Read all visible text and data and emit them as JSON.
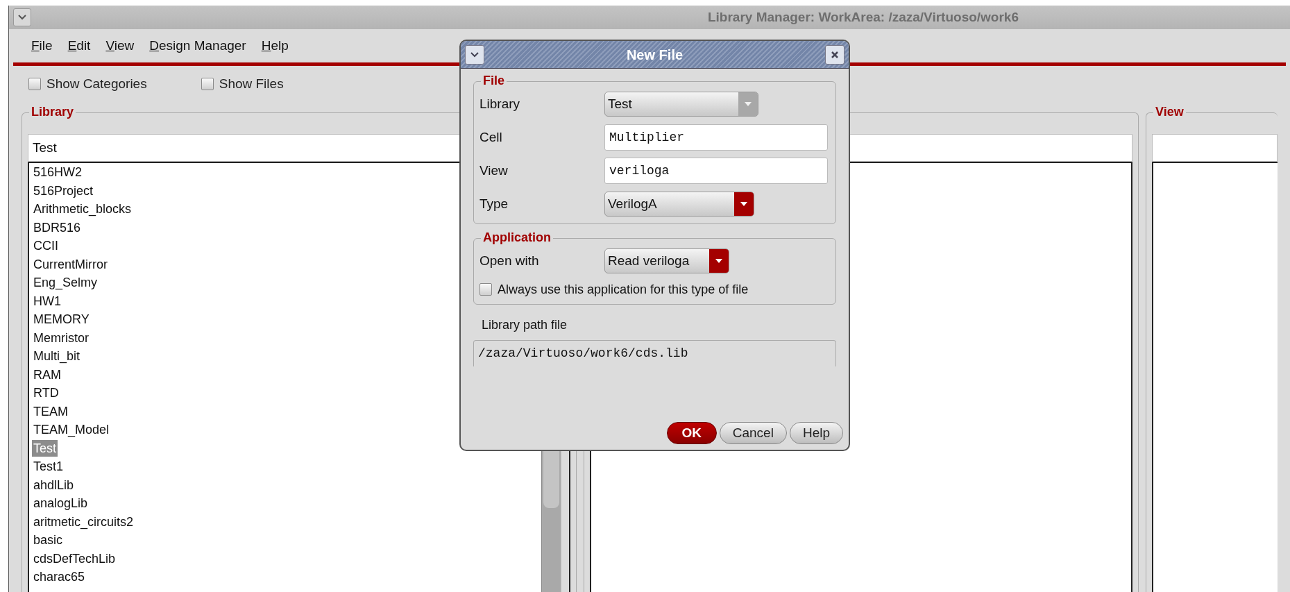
{
  "window": {
    "title": "Library Manager: WorkArea: /zaza/Virtuoso/work6"
  },
  "menu": [
    {
      "label": "File"
    },
    {
      "label": "Edit"
    },
    {
      "label": "View"
    },
    {
      "label": "Design Manager"
    },
    {
      "label": "Help"
    }
  ],
  "options": [
    {
      "label": "Show Categories",
      "checked": false
    },
    {
      "label": "Show Files",
      "checked": false
    }
  ],
  "library_panel": {
    "title": "Library",
    "filter": "Test",
    "items": [
      {
        "label": "516HW2",
        "selected": false
      },
      {
        "label": "516Project",
        "selected": false
      },
      {
        "label": "Arithmetic_blocks",
        "selected": false
      },
      {
        "label": "BDR516",
        "selected": false
      },
      {
        "label": "CCII",
        "selected": false
      },
      {
        "label": "CurrentMirror",
        "selected": false
      },
      {
        "label": "Eng_Selmy",
        "selected": false
      },
      {
        "label": "HW1",
        "selected": false
      },
      {
        "label": "MEMORY",
        "selected": false
      },
      {
        "label": "Memristor",
        "selected": false
      },
      {
        "label": "Multi_bit",
        "selected": false
      },
      {
        "label": "RAM",
        "selected": false
      },
      {
        "label": "RTD",
        "selected": false
      },
      {
        "label": "TEAM",
        "selected": false
      },
      {
        "label": "TEAM_Model",
        "selected": false
      },
      {
        "label": "Test",
        "selected": true
      },
      {
        "label": "Test1",
        "selected": false
      },
      {
        "label": "ahdlLib",
        "selected": false
      },
      {
        "label": "analogLib",
        "selected": false
      },
      {
        "label": "aritmetic_circuits2",
        "selected": false
      },
      {
        "label": "basic",
        "selected": false
      },
      {
        "label": "cdsDefTechLib",
        "selected": false
      },
      {
        "label": "charac65",
        "selected": false
      }
    ]
  },
  "view_panel": {
    "title": "View"
  },
  "dialog": {
    "title": "New File",
    "file_group": {
      "title": "File",
      "fields": [
        {
          "label": "Library",
          "kind": "select",
          "value": "Test",
          "disabled": true
        },
        {
          "label": "Cell",
          "kind": "text",
          "value": "Multiplier"
        },
        {
          "label": "View",
          "kind": "text",
          "value": "veriloga"
        },
        {
          "label": "Type",
          "kind": "select",
          "value": "VerilogA",
          "disabled": false
        }
      ]
    },
    "application_group": {
      "title": "Application",
      "open_with_label": "Open with",
      "open_with": "Read veriloga",
      "always_use": {
        "label": "Always use this application for this type of file",
        "checked": false
      }
    },
    "path_label": "Library path file",
    "path": "/zaza/Virtuoso/work6/cds.lib",
    "buttons": [
      {
        "label": "OK",
        "default": true
      },
      {
        "label": "Cancel",
        "default": false
      },
      {
        "label": "Help",
        "default": false
      }
    ]
  }
}
